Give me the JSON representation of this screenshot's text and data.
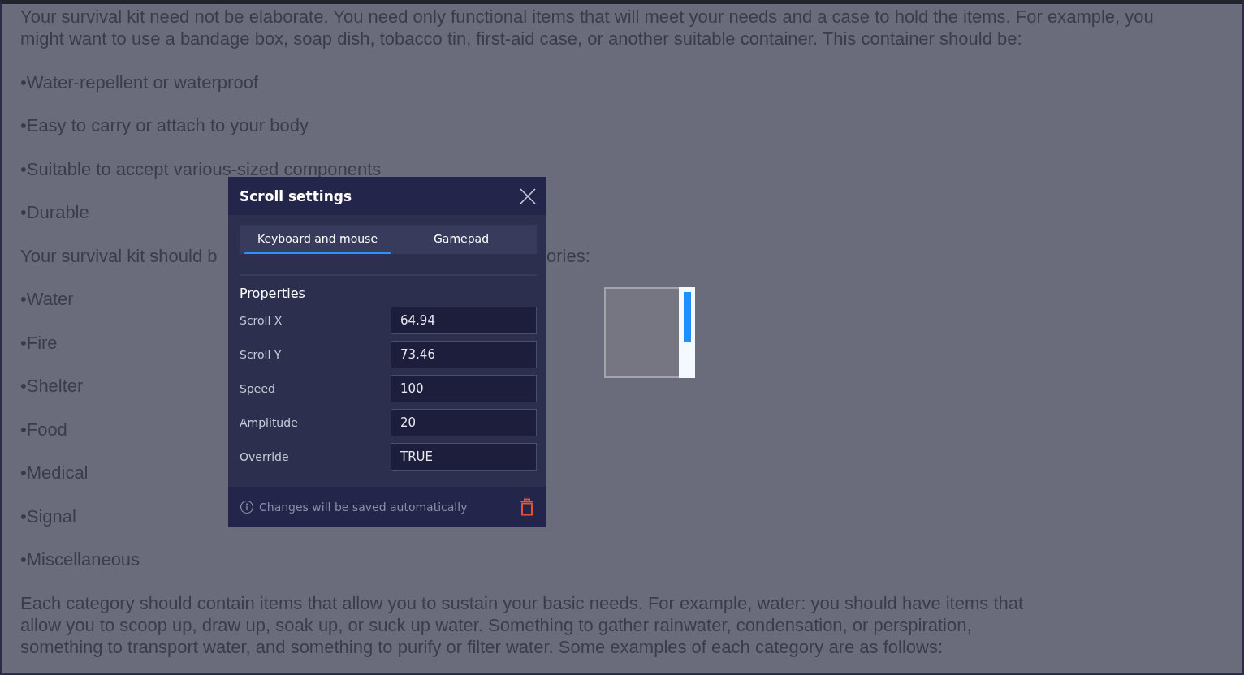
{
  "article": {
    "paragraphs": [
      {
        "kind": "text",
        "text": "Your survival kit need not be elaborate. You need only functional items that will meet your needs and a case to hold the items. For example, you might want to use a bandage box, soap dish, tobacco tin, first-aid case, or another suitable container. This container should be:"
      },
      {
        "kind": "text",
        "text": "•Water-repellent or waterproof"
      },
      {
        "kind": "text",
        "text": "•Easy to carry or attach to your body"
      },
      {
        "kind": "text",
        "text": "•Suitable to accept various-sized components"
      },
      {
        "kind": "text",
        "text": "•Durable"
      },
      {
        "kind": "split",
        "text": "Your survival kit should b",
        "text_after": "ories:"
      },
      {
        "kind": "text",
        "text": "•Water"
      },
      {
        "kind": "text",
        "text": "•Fire"
      },
      {
        "kind": "text",
        "text": "•Shelter"
      },
      {
        "kind": "text",
        "text": "•Food"
      },
      {
        "kind": "text",
        "text": "•Medical"
      },
      {
        "kind": "text",
        "text": "•Signal"
      },
      {
        "kind": "text",
        "text": "•Miscellaneous"
      },
      {
        "kind": "text",
        "text": "Each category should contain items that allow you to sustain your basic needs. For example, water: you should have items that allow you to scoop up, draw up, soak up, or suck up water. Something to gather rainwater, condensation, or perspiration, something to transport water, and something to purify or filter water. Some examples of each category are as follows:"
      }
    ]
  },
  "dialog": {
    "title": "Scroll settings",
    "tabs": [
      {
        "label": "Keyboard and mouse",
        "selected": true
      },
      {
        "label": "Gamepad",
        "selected": false
      }
    ],
    "section_title": "Properties",
    "properties": [
      {
        "label": "Scroll X",
        "value": "64.94"
      },
      {
        "label": "Scroll Y",
        "value": "73.46"
      },
      {
        "label": "Speed",
        "value": "100"
      },
      {
        "label": "Amplitude",
        "value": "20"
      },
      {
        "label": "Override",
        "value": "TRUE"
      }
    ],
    "footer_note": "Changes will be saved automatically"
  }
}
